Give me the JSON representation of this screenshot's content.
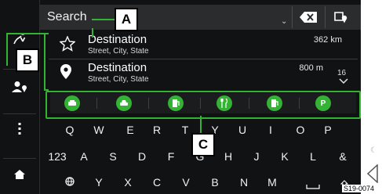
{
  "search": {
    "label": "Search"
  },
  "results": [
    {
      "title": "Destination",
      "subtitle": "Street, City, State",
      "distance": "362 km",
      "icon": "star-icon"
    },
    {
      "title": "Destination",
      "subtitle": "Street, City, State",
      "distance": "800 m",
      "icon": "location-pin-icon"
    }
  ],
  "pagination": {
    "count": "16"
  },
  "categories": [
    "fuel-station-icon",
    "car-service-icon",
    "ev-charging-icon",
    "restaurant-icon",
    "ev-charging-2-icon",
    "parking-icon"
  ],
  "category_labels": {
    "parking": "P"
  },
  "keyboard": {
    "row1": [
      "Q",
      "W",
      "E",
      "R",
      "T",
      "Y",
      "U",
      "I",
      "O",
      "P"
    ],
    "row2": [
      "123",
      "A",
      "S",
      "D",
      "F",
      "G",
      "H",
      "J",
      "K",
      "L",
      "&"
    ],
    "row3": [
      "Y",
      "X",
      "C",
      "V",
      "B",
      "N",
      "M"
    ]
  },
  "callouts": {
    "a": "A",
    "b": "B",
    "c": "C"
  },
  "figure_ref": "S19-0074",
  "colors": {
    "accent": "#34b233",
    "screen_bg": "#111213",
    "bar_bg": "#2a2c2e"
  }
}
